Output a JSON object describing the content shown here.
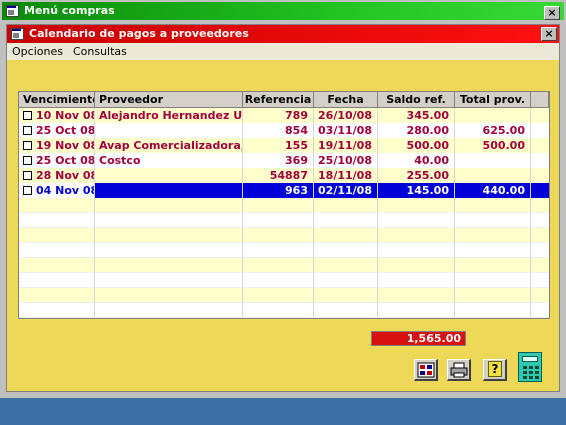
{
  "outer_window": {
    "title": "Menú compras",
    "close_label": "×"
  },
  "inner_window": {
    "title": "Calendario de pagos a proveedores",
    "close_label": "×"
  },
  "menu": {
    "items": [
      "Opciones",
      "Consultas"
    ]
  },
  "grid": {
    "columns": [
      "Vencimiento",
      "Proveedor",
      "Referencia",
      "Fecha",
      "Saldo ref.",
      "Total prov."
    ],
    "rows": [
      {
        "vencimiento": "10 Nov 08",
        "proveedor": "Alejandro Hernandez Urtiz",
        "referencia": "789",
        "fecha": "26/10/08",
        "saldo": "345.00",
        "total": "",
        "selected": false
      },
      {
        "vencimiento": "25 Oct 08",
        "proveedor": "",
        "referencia": "854",
        "fecha": "03/11/08",
        "saldo": "280.00",
        "total": "625.00",
        "selected": false
      },
      {
        "vencimiento": "19 Nov 08",
        "proveedor": "Avap Comercializadora, ...",
        "referencia": "155",
        "fecha": "19/11/08",
        "saldo": "500.00",
        "total": "500.00",
        "selected": false
      },
      {
        "vencimiento": "25 Oct 08",
        "proveedor": "Costco",
        "referencia": "369",
        "fecha": "25/10/08",
        "saldo": "40.00",
        "total": "",
        "selected": false
      },
      {
        "vencimiento": "28 Nov 08",
        "proveedor": "",
        "referencia": "54887",
        "fecha": "18/11/08",
        "saldo": "255.00",
        "total": "",
        "selected": false
      },
      {
        "vencimiento": "04 Nov 08",
        "proveedor": "",
        "referencia": "963",
        "fecha": "02/11/08",
        "saldo": "145.00",
        "total": "440.00",
        "selected": true
      }
    ]
  },
  "total": {
    "value": "1,565.00"
  },
  "toolbar": {
    "buttons": [
      {
        "icon": "report-icon"
      },
      {
        "icon": "printer-icon"
      },
      {
        "icon": "help-icon",
        "glyph": "?"
      },
      {
        "icon": "calculator-icon"
      }
    ]
  },
  "colors": {
    "outer_title": "#22c322",
    "inner_title": "#ff1010",
    "form_bg": "#eed858",
    "row_text": "#a0003c",
    "selection": "#0000d8",
    "total_bg": "#d81010"
  }
}
